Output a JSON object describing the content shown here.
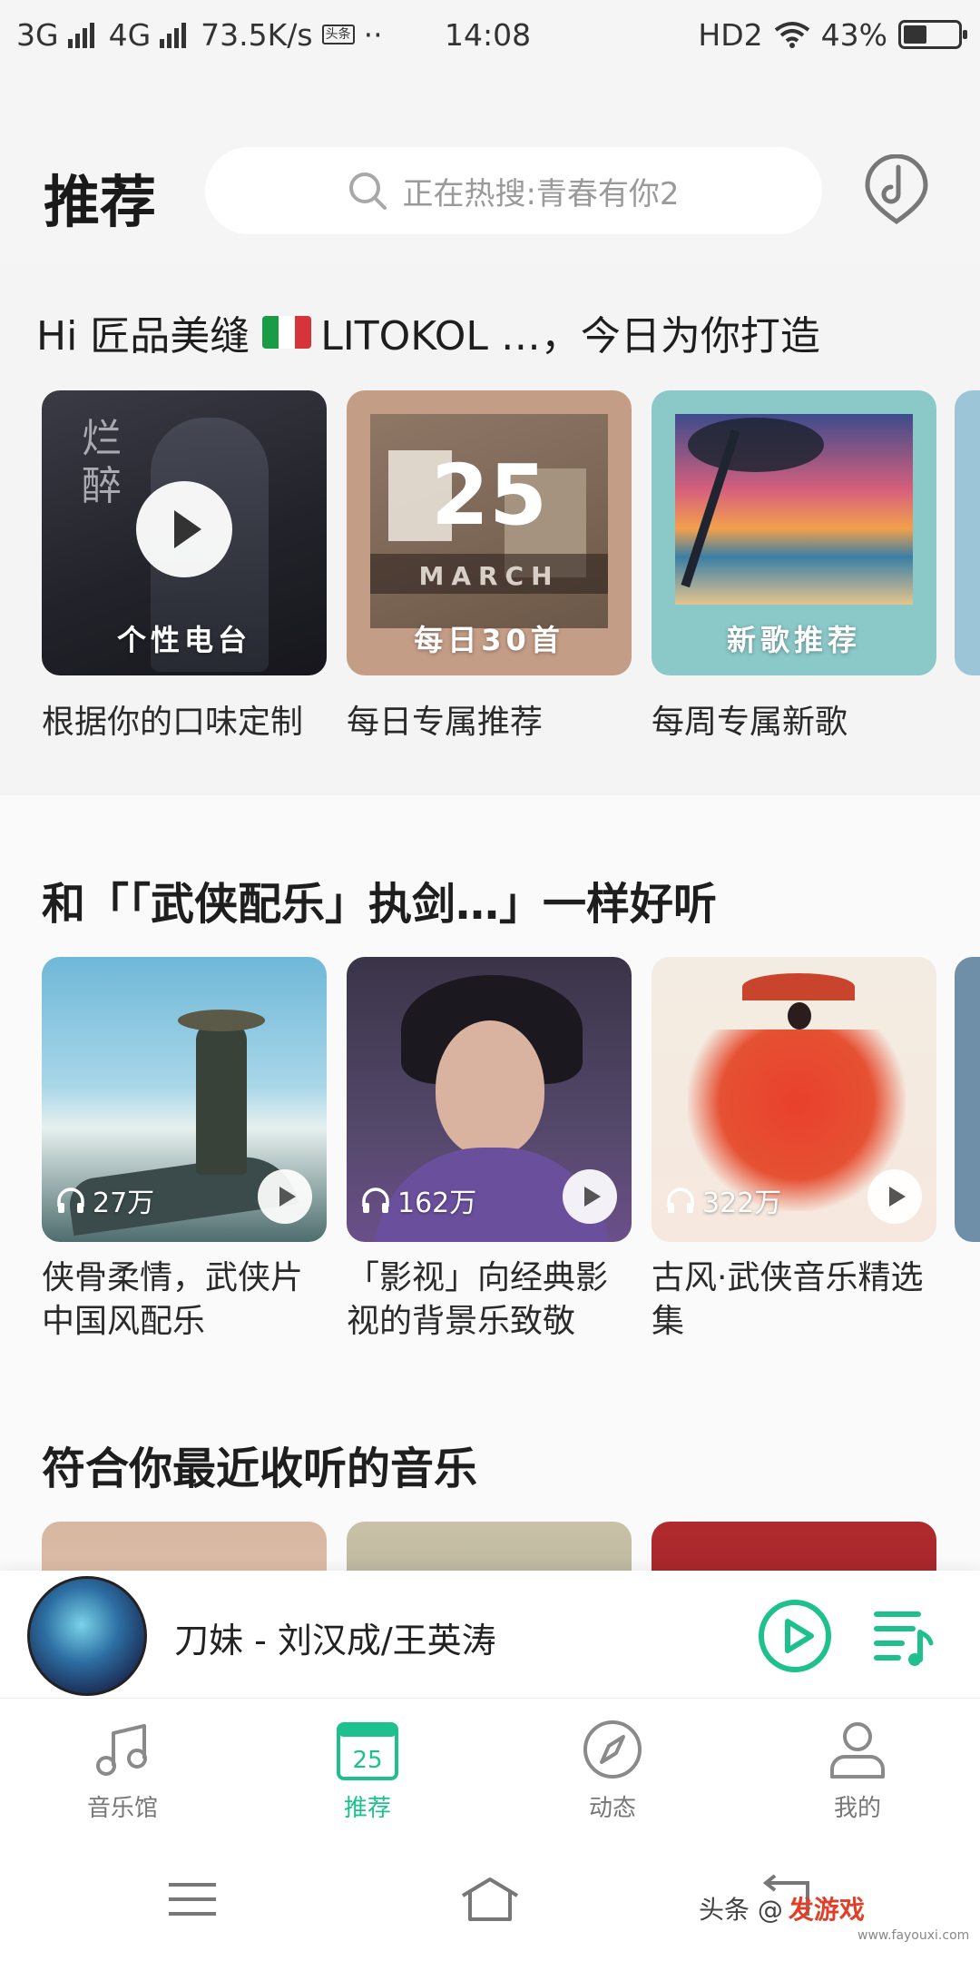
{
  "status_bar": {
    "network1": "3G",
    "network2": "4G",
    "speed": "73.5K/s",
    "app_badge": "头条",
    "dots": "··",
    "time": "14:08",
    "hd": "HD2",
    "battery": "43%",
    "battery_level": 0.43
  },
  "header": {
    "title": "推荐",
    "search_placeholder": "正在热搜:青春有你2"
  },
  "greeting": {
    "prefix": "Hi 匠品美缝",
    "suffix": "LITOKOL …，今日为你打造"
  },
  "featured": [
    {
      "cover_label": "个性电台",
      "caption": "根据你的口味定制"
    },
    {
      "cover_label": "每日30首",
      "caption": "每日专属推荐",
      "day": "25",
      "month": "MARCH"
    },
    {
      "cover_label": "新歌推荐",
      "caption": "每周专属新歌"
    }
  ],
  "similar_section": {
    "title": "和「「武侠配乐」执剑…」一样好听",
    "playlists": [
      {
        "plays": "27万",
        "title": "侠骨柔情，武侠片中国风配乐"
      },
      {
        "plays": "162万",
        "title": "「影视」向经典影视的背景乐致敬"
      },
      {
        "plays": "322万",
        "title": "古风·武侠音乐精选集"
      }
    ]
  },
  "recent_section": {
    "title": "符合你最近收听的音乐"
  },
  "player": {
    "title": "刀妹 - 刘汉成/王英涛"
  },
  "tabs": [
    {
      "label": "音乐馆",
      "active": false
    },
    {
      "label": "推荐",
      "active": true,
      "icon_text": "25"
    },
    {
      "label": "动态",
      "active": false
    },
    {
      "label": "我的",
      "active": false
    }
  ],
  "watermark": {
    "text": "头条 @",
    "brand": "发游戏",
    "url": "www.fayouxi.com"
  },
  "colors": {
    "accent": "#1ec18e",
    "background": "#f5f5f5"
  }
}
